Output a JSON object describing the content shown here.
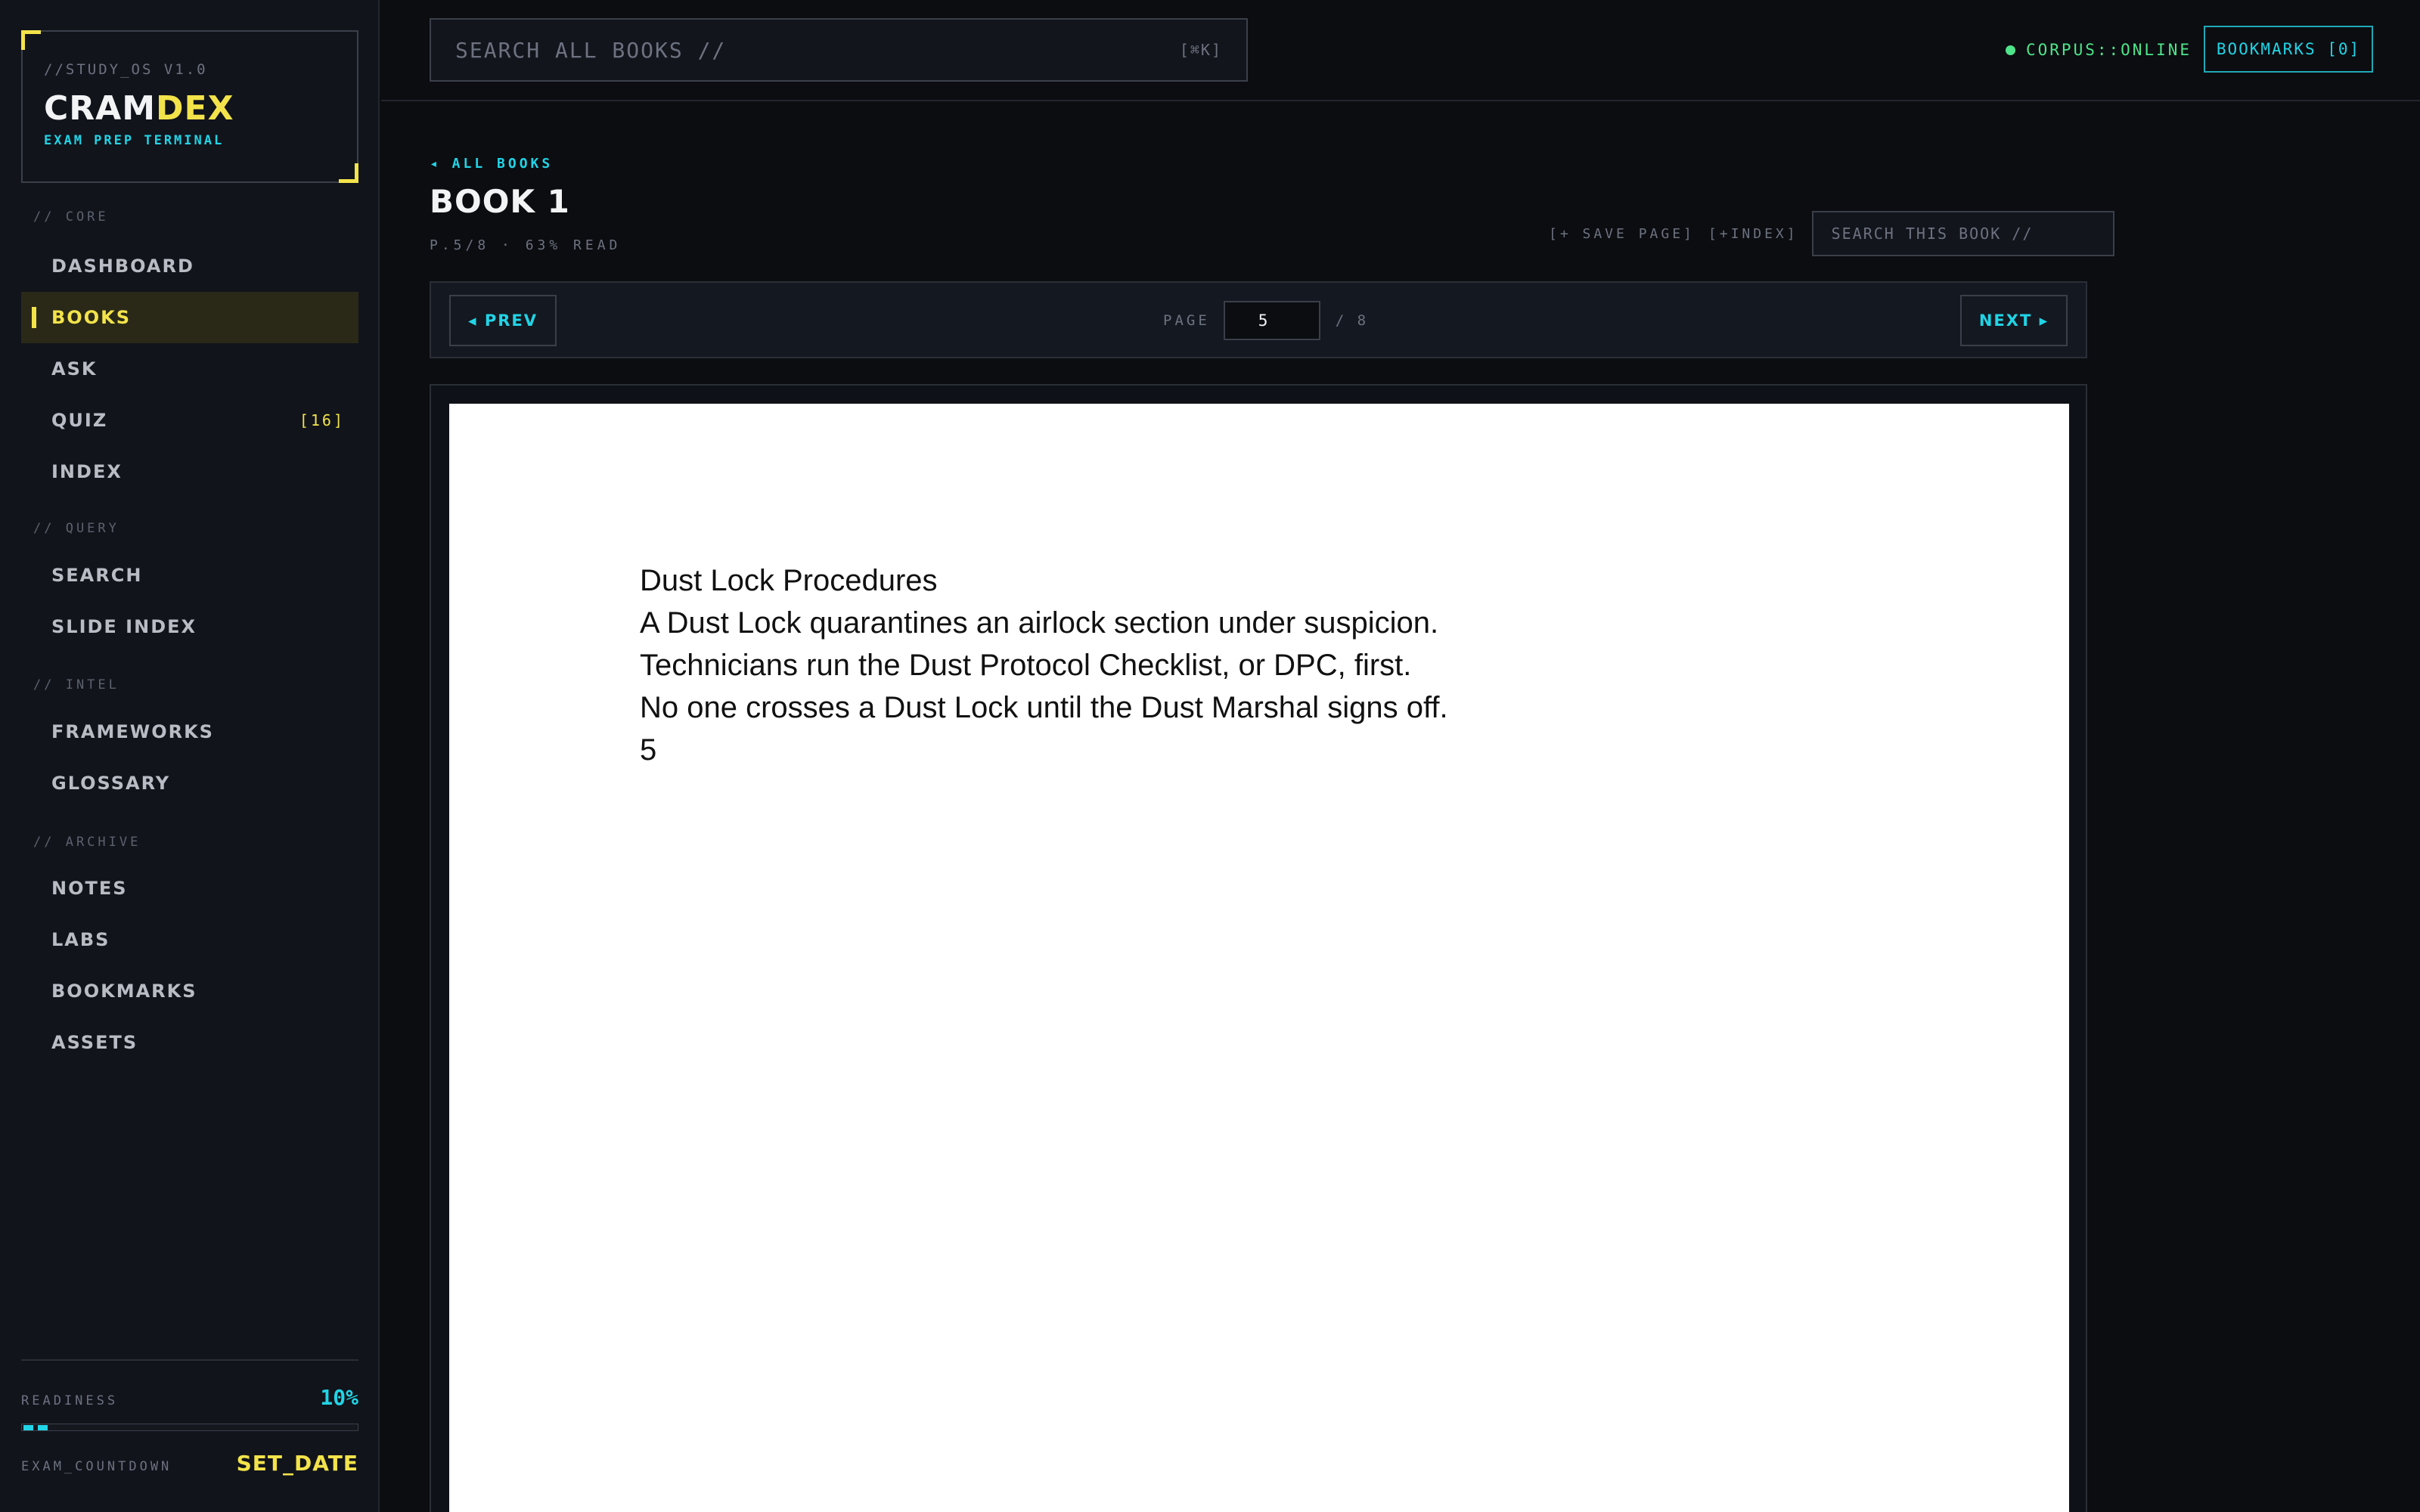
{
  "brand": {
    "pre": "//STUDY_OS V1.0",
    "name_main": "CRAM",
    "name_accent": "DEX",
    "subtitle": "EXAM PREP TERMINAL",
    "accent_color": "#f3e34a"
  },
  "sidebar": {
    "sections": [
      {
        "label": "// CORE",
        "items": [
          {
            "label": "DASHBOARD",
            "active": false
          },
          {
            "label": "BOOKS",
            "active": true
          },
          {
            "label": "ASK",
            "active": false
          },
          {
            "label": "QUIZ",
            "badge": "[16]",
            "active": false
          },
          {
            "label": "INDEX",
            "active": false
          }
        ]
      },
      {
        "label": "// QUERY",
        "items": [
          {
            "label": "SEARCH",
            "active": false
          },
          {
            "label": "SLIDE INDEX",
            "active": false
          }
        ]
      },
      {
        "label": "// INTEL",
        "items": [
          {
            "label": "FRAMEWORKS",
            "active": false
          },
          {
            "label": "GLOSSARY",
            "active": false
          }
        ]
      },
      {
        "label": "// ARCHIVE",
        "items": [
          {
            "label": "NOTES",
            "active": false
          },
          {
            "label": "LABS",
            "active": false
          },
          {
            "label": "BOOKMARKS",
            "active": false
          },
          {
            "label": "ASSETS",
            "active": false
          }
        ]
      }
    ],
    "footer": {
      "readiness_label": "READINESS",
      "readiness_value": "10%",
      "readiness_fraction": 0.1,
      "countdown_label": "EXAM_COUNTDOWN",
      "countdown_value": "SET_DATE"
    }
  },
  "topbar": {
    "search_placeholder": "SEARCH ALL BOOKS //",
    "search_shortcut": "[⌘K]",
    "status": "CORPUS::ONLINE",
    "status_color": "#4ee58a",
    "bookmarks_label": "BOOKMARKS [0]"
  },
  "book": {
    "back_link": "◂ ALL BOOKS",
    "title": "BOOK 1",
    "meta": "P.5/8 · 63% READ",
    "save_page": "[+ SAVE PAGE]",
    "add_index": "[+INDEX]",
    "search_placeholder": "SEARCH THIS BOOK //",
    "pager": {
      "prev_label": "◂ PREV",
      "next_label": "NEXT ▸",
      "page_label": "PAGE",
      "current_page": "5",
      "total": "/ 8"
    },
    "page_lines": [
      "Dust Lock Procedures",
      "A Dust Lock quarantines an airlock section under suspicion.",
      "Technicians run the Dust Protocol Checklist, or DPC, first.",
      "No one crosses a Dust Lock until the Dust Marshal signs off.",
      "5"
    ]
  },
  "colors": {
    "cyan_accent": "#21d4e6",
    "yellow_accent": "#f3e34a",
    "background": "#0b0d11"
  }
}
